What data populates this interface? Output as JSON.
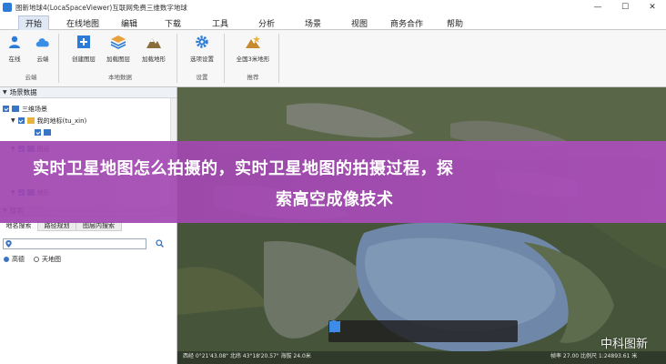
{
  "window": {
    "title": "图新地球4(LocaSpaceViewer)互联网免费三维数字地球",
    "minimize": "—",
    "maximize": "☐",
    "close": "✕"
  },
  "menu": {
    "tabs": [
      "开始",
      "在线地图",
      "编辑",
      "下载",
      "工具",
      "分析",
      "场景",
      "视图",
      "商务合作",
      "帮助"
    ]
  },
  "ribbon": {
    "buttons": [
      "在线",
      "云端",
      "创建图层",
      "加载图层",
      "加载地形",
      "选项设置",
      "全国3米地形"
    ],
    "groups": [
      "云端",
      "本地数据",
      "设置",
      "推荐"
    ]
  },
  "left_panel": {
    "scene_header": "场景数据",
    "tree": {
      "root": "三维场景",
      "my_layer": "我的地标(tu_xin)",
      "layers": "图层",
      "terrain": "地形"
    },
    "search_header": "搜索",
    "search_tabs": [
      "地名搜索",
      "路径规划",
      "图层内搜索"
    ],
    "search_placeholder": "",
    "sources": [
      "高德",
      "天地图"
    ]
  },
  "map": {
    "status_left": "西经 0°21'43.08\" 北纬 43°18'20.57\"  海拔 24.0米",
    "status_right": "帧率 27.00  比例尺 1:24893.61 米",
    "watermark": "中科图新"
  },
  "overlay": {
    "line1": "实时卫星地图怎么拍摄的，实时卫星地图的拍摄过程，探",
    "line2": "索高空成像技术"
  },
  "colors": {
    "accent": "#2c7bd9",
    "banner": "#a64cb8",
    "checkbox": "#3a74c4"
  }
}
